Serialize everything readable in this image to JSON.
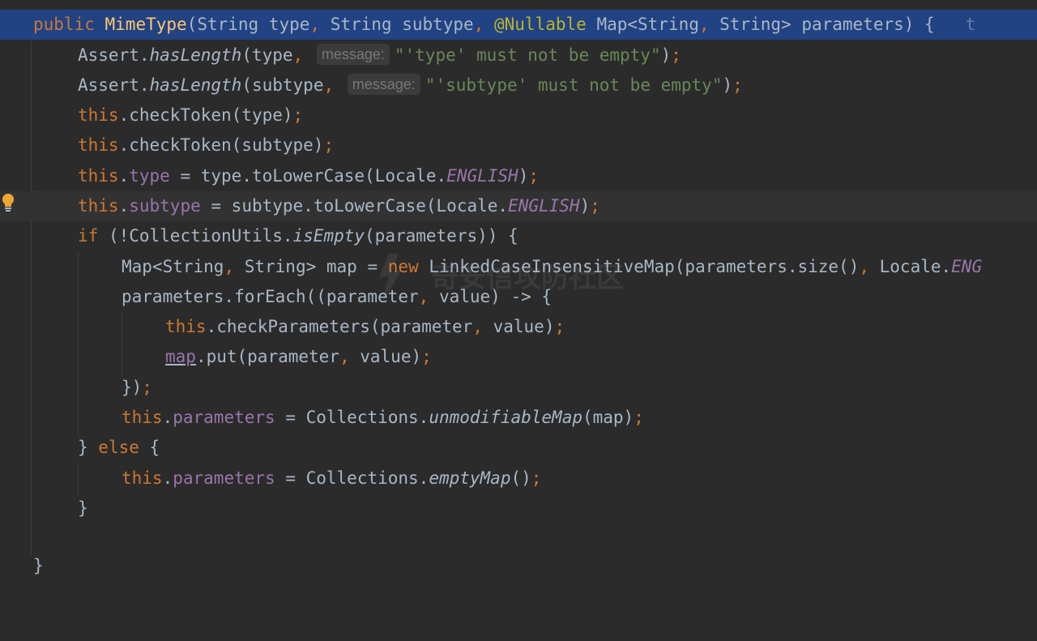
{
  "editor": {
    "lines": {
      "l1": {
        "kw_public": "public ",
        "ctor": "MimeType",
        "p1": "(String type",
        "c1": ", ",
        "p2": "String subtype",
        "c2": ", ",
        "ann": "@Nullable",
        "p3": " Map<String",
        "c3": ", ",
        "p4": "String> parameters) {",
        "tail": "   t"
      },
      "l2": {
        "a": "Assert.",
        "m": "hasLength",
        "b": "(type",
        "c": ", ",
        "hint": "message:",
        "s": "\"'type' must not be empty\"",
        "e": ")",
        "semi": ";"
      },
      "l3": {
        "a": "Assert.",
        "m": "hasLength",
        "b": "(subtype",
        "c": ", ",
        "hint": "message:",
        "s": "\"'subtype' must not be empty\"",
        "e": ")",
        "semi": ";"
      },
      "l4": {
        "kw": "this",
        "rest": ".checkToken(type)",
        "semi": ";"
      },
      "l5": {
        "kw": "this",
        "rest": ".checkToken(subtype)",
        "semi": ";"
      },
      "l6": {
        "kw": "this",
        "dot": ".",
        "f": "type",
        "mid": " = type.toLowerCase(Locale.",
        "c": "ENGLISH",
        "end": ")",
        "semi": ";"
      },
      "l7": {
        "kw": "this",
        "dot": ".",
        "f": "subtype",
        "mid": " = subtype.toLowerCase(Locale.",
        "c": "ENGLISH",
        "end": ")",
        "semi": ";"
      },
      "l8": {
        "kw": "if",
        "a": " (!CollectionUtils.",
        "m": "isEmpty",
        "b": "(parameters)) {"
      },
      "l9": {
        "a": "Map<String",
        "c": ", ",
        "b": "String> map = ",
        "kw": "new",
        "d": " LinkedCaseInsensitiveMap(parameters.size()",
        "c2": ", ",
        "e": "Locale.",
        "f": "ENG"
      },
      "l10": {
        "a": "parameters.forEach((parameter",
        "c": ", ",
        "b": "value) -> {"
      },
      "l11": {
        "kw": "this",
        "a": ".checkParameters(parameter",
        "c": ", ",
        "b": "value)",
        "semi": ";"
      },
      "l12": {
        "v": "map",
        "a": ".put(parameter",
        "c": ", ",
        "b": "value)",
        "semi": ";"
      },
      "l13": {
        "a": "})",
        "semi": ";"
      },
      "l14": {
        "kw": "this",
        "dot": ".",
        "f": "parameters",
        "a": " = Collections.",
        "m": "unmodifiableMap",
        "b": "(map)",
        "semi": ";"
      },
      "l15": {
        "a": "} ",
        "kw": "else",
        "b": " {"
      },
      "l16": {
        "kw": "this",
        "dot": ".",
        "f": "parameters",
        "a": " = Collections.",
        "m": "emptyMap",
        "b": "()",
        "semi": ";"
      },
      "l17": {
        "a": "}"
      },
      "l18": {
        "a": ""
      },
      "l19": {
        "a": "}"
      }
    },
    "icons": {
      "intention": "lightbulb-icon"
    },
    "watermark": "奇安信攻防社区",
    "colors": {
      "background": "#2b2b2b",
      "keyword": "#cc7832",
      "method_decl": "#ffc66d",
      "annotation": "#bbb529",
      "field": "#9876aa",
      "string": "#6a8759",
      "plain": "#a9b7c6",
      "selection": "#214283"
    }
  }
}
